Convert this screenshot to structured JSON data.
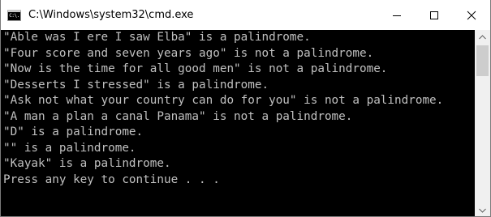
{
  "window": {
    "title": "C:\\Windows\\system32\\cmd.exe",
    "icon_text": "C:\\."
  },
  "controls": [
    "minimize-icon",
    "maximize-icon",
    "close-icon"
  ],
  "console": {
    "lines": [
      "\"Able was I ere I saw Elba\" is a palindrome.",
      "\"Four score and seven years ago\" is not a palindrome.",
      "\"Now is the time for all good men\" is not a palindrome.",
      "\"Desserts I stressed\" is a palindrome.",
      "\"Ask not what your country can do for you\" is not a palindrome.",
      "\"A man a plan a canal Panama\" is not a palindrome.",
      "\"D\" is a palindrome.",
      "\"\" is a palindrome.",
      "\"Kayak\" is a palindrome.",
      "Press any key to continue . . ."
    ]
  },
  "colors": {
    "console_background": "#000000",
    "console_text": "#c0c0c0",
    "titlebar": "#ffffff"
  }
}
